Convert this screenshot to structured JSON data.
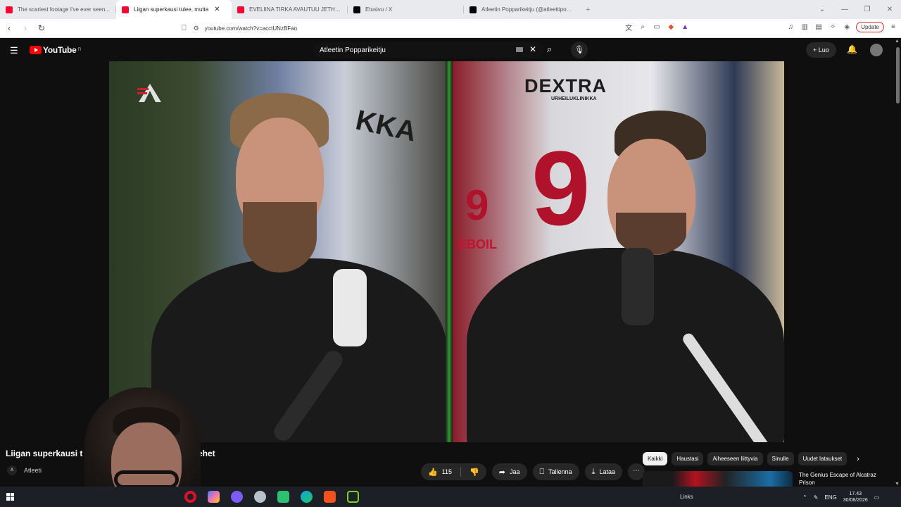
{
  "browser": {
    "tabs": [
      {
        "title": "The scariest footage I've ever seen...",
        "favicon_color": "#ff0033",
        "active": false
      },
      {
        "title": "Liigan superkausi tulee, mutta",
        "favicon_color": "#ff0033",
        "active": true,
        "audio": true
      },
      {
        "title": "EVELIINA TIRKA AVAUTUU JETHRO...",
        "favicon_color": "#ff0033",
        "active": false
      },
      {
        "title": "Etusivu / X",
        "favicon_color": "#000000",
        "active": false
      },
      {
        "title": "Atleetin Popparikeitju (@atleettipopp...",
        "favicon_color": "#000000",
        "active": false
      }
    ],
    "new_tab": "+",
    "url": "youtube.com/watch?v=acctUNzBFao",
    "update_label": "Update"
  },
  "youtube": {
    "logo_text": "YouTube",
    "region": "FI",
    "search_value": "Atleetin Popparikeitju",
    "create_label": "Luo"
  },
  "video": {
    "jersey_left_text": "KKA",
    "jersey_right_brand": "DEXTRA",
    "jersey_right_sub": "URHEILUKLINIKKA",
    "jersey_right_number": "9",
    "jersey_right_side_number": "9",
    "sponsor_text": "EBOIL"
  },
  "below_video": {
    "title_part1": "Liigan superkausi t",
    "title_part2": "ehet",
    "channel": "Atleeti",
    "likes": "115",
    "share_label": "Jaa",
    "save_label": "Tallenna",
    "download_label": "Lataa"
  },
  "chips": [
    "Kaikki",
    "Haustasi",
    "Aiheeseen liittyvia",
    "Sinulle",
    "Uudet lataukset"
  ],
  "recommendation": {
    "title": "The Genius Escape of Alcatraz Prison"
  },
  "taskbar": {
    "links_label": "Links",
    "lang": "ENG",
    "time": "17.43",
    "date": "30/08/2026"
  }
}
